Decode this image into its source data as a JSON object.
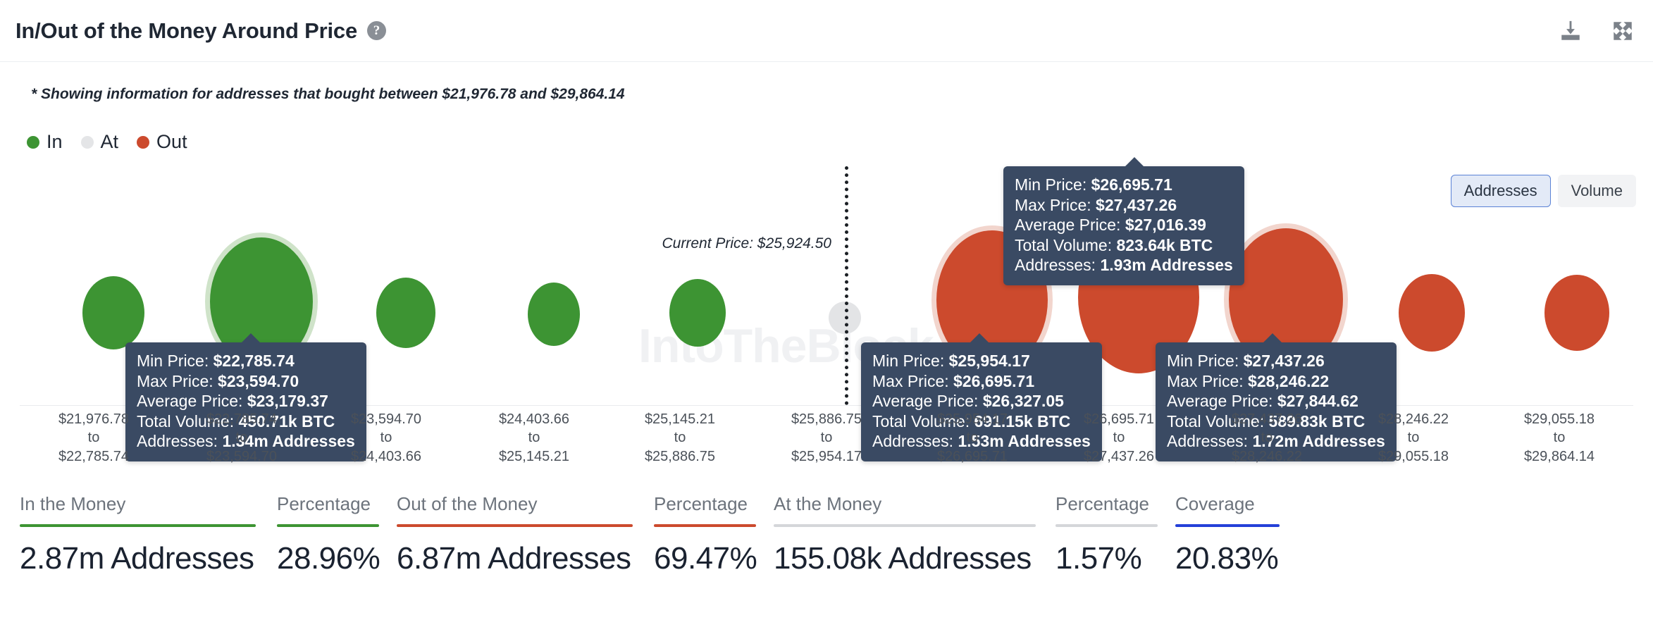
{
  "header": {
    "title": "In/Out of the Money Around Price",
    "help_icon": "question-mark-icon",
    "download_label": "download-icon",
    "expand_label": "fullscreen-icon"
  },
  "subnote": "* Showing information for addresses that bought between $21,976.78 and $29,864.14",
  "legend": {
    "items": [
      {
        "label": "In",
        "color": "#3d9433"
      },
      {
        "label": "At",
        "color": "#e4e5e7"
      },
      {
        "label": "Out",
        "color": "#cc4a2d"
      }
    ]
  },
  "series_toggle": {
    "options": [
      {
        "label": "Addresses",
        "active": true
      },
      {
        "label": "Volume",
        "active": false
      }
    ]
  },
  "current_price": {
    "label": "Current Price: $25,924.50",
    "value": "$25,924.50"
  },
  "watermark": {
    "text": "IntoTheBlock"
  },
  "chart_data": {
    "type": "bar",
    "title": "In/Out of the Money Around Price",
    "xlabel": "",
    "ylabel": "Addresses",
    "grid": false,
    "legend_position": "top-left",
    "current_price": 25924.5,
    "unit": "Addresses",
    "categories": [
      "$21,976.78\nto\n$22,785.74",
      "$22,785.74\nto\n$23,594.70",
      "$23,594.70\nto\n$24,403.66",
      "$24,403.66\nto\n$25,145.21",
      "$25,145.21\nto\n$25,886.75",
      "$25,886.75\nto\n$25,954.17",
      "$25,954.17\nto\n$26,695.71",
      "$26,695.71\nto\n$27,437.26",
      "$27,437.26\nto\n$28,246.22",
      "$28,246.22\nto\n$29,055.18",
      "$29,055.18\nto\n$29,864.14"
    ],
    "points": [
      {
        "min_price": "$21,976.78",
        "max_price": "$22,785.74",
        "state": "in",
        "addresses": "0.62m",
        "value": 0.62
      },
      {
        "min_price": "$22,785.74",
        "max_price": "$23,594.70",
        "average_price": "$23,179.37",
        "total_volume": "450.71k BTC",
        "addresses": "1.34m Addresses",
        "state": "in",
        "value": 1.34,
        "hovered": true
      },
      {
        "min_price": "$23,594.70",
        "max_price": "$24,403.66",
        "state": "in",
        "addresses": "0.55m",
        "value": 0.55
      },
      {
        "min_price": "$24,403.66",
        "max_price": "$25,145.21",
        "state": "in",
        "addresses": "0.42m",
        "value": 0.42
      },
      {
        "min_price": "$25,145.21",
        "max_price": "$25,886.75",
        "state": "in",
        "addresses": "0.50m",
        "value": 0.5
      },
      {
        "min_price": "$25,886.75",
        "max_price": "$25,954.17",
        "state": "at",
        "addresses": "155.08k",
        "value": 0.155
      },
      {
        "min_price": "$25,954.17",
        "max_price": "$26,695.71",
        "average_price": "$26,327.05",
        "total_volume": "691.15k BTC",
        "addresses": "1.53m Addresses",
        "state": "out",
        "value": 1.53,
        "hovered": true
      },
      {
        "min_price": "$26,695.71",
        "max_price": "$27,437.26",
        "average_price": "$27,016.39",
        "total_volume": "823.64k BTC",
        "addresses": "1.93m Addresses",
        "state": "out",
        "value": 1.93,
        "hovered": true
      },
      {
        "min_price": "$27,437.26",
        "max_price": "$28,246.22",
        "average_price": "$27,844.62",
        "total_volume": "589.83k BTC",
        "addresses": "1.72m Addresses",
        "state": "out",
        "value": 1.72,
        "hovered": true
      },
      {
        "min_price": "$28,246.22",
        "max_price": "$29,055.18",
        "state": "out",
        "addresses": "0.62m",
        "value": 0.62
      },
      {
        "min_price": "$29,055.18",
        "max_price": "$29,864.14",
        "state": "out",
        "addresses": "0.60m",
        "value": 0.6
      }
    ]
  },
  "tooltips": [
    {
      "id": "tooltip-bin-2",
      "min_price_label": "Min Price: ",
      "min_price": "$22,785.74",
      "max_price_label": "Max Price: ",
      "max_price": "$23,594.70",
      "avg_price_label": "Average Price: ",
      "avg_price": "$23,179.37",
      "volume_label": "Total Volume: ",
      "volume": "450.71k BTC",
      "addresses_label": "Addresses: ",
      "addresses": "1.34m Addresses"
    },
    {
      "id": "tooltip-bin-8",
      "min_price_label": "Min Price: ",
      "min_price": "$26,695.71",
      "max_price_label": "Max Price: ",
      "max_price": "$27,437.26",
      "avg_price_label": "Average Price: ",
      "avg_price": "$27,016.39",
      "volume_label": "Total Volume: ",
      "volume": "823.64k BTC",
      "addresses_label": "Addresses: ",
      "addresses": "1.93m Addresses"
    },
    {
      "id": "tooltip-bin-7",
      "min_price_label": "Min Price: ",
      "min_price": "$25,954.17",
      "max_price_label": "Max Price: ",
      "max_price": "$26,695.71",
      "avg_price_label": "Average Price: ",
      "avg_price": "$26,327.05",
      "volume_label": "Total Volume: ",
      "volume": "691.15k BTC",
      "addresses_label": "Addresses: ",
      "addresses": "1.53m Addresses"
    },
    {
      "id": "tooltip-bin-9",
      "min_price_label": "Min Price: ",
      "min_price": "$27,437.26",
      "max_price_label": "Max Price: ",
      "max_price": "$28,246.22",
      "avg_price_label": "Average Price: ",
      "avg_price": "$27,844.62",
      "volume_label": "Total Volume: ",
      "volume": "589.83k BTC",
      "addresses_label": "Addresses: ",
      "addresses": "1.72m Addresses"
    }
  ],
  "xaxis": {
    "labels": [
      {
        "from": "$21,976.78",
        "sep": "to",
        "to": "$22,785.74"
      },
      {
        "from": "$22,785.74",
        "sep": "to",
        "to": "$23,594.70"
      },
      {
        "from": "$23,594.70",
        "sep": "to",
        "to": "$24,403.66"
      },
      {
        "from": "$24,403.66",
        "sep": "to",
        "to": "$25,145.21"
      },
      {
        "from": "$25,145.21",
        "sep": "to",
        "to": "$25,886.75"
      },
      {
        "from": "$25,886.75",
        "sep": "to",
        "to": "$25,954.17"
      },
      {
        "from": "$25,954.17",
        "sep": "to",
        "to": "$26,695.71"
      },
      {
        "from": "$26,695.71",
        "sep": "to",
        "to": "$27,437.26"
      },
      {
        "from": "$27,437.26",
        "sep": "to",
        "to": "$28,246.22"
      },
      {
        "from": "$28,246.22",
        "sep": "to",
        "to": "$29,055.18"
      },
      {
        "from": "$29,055.18",
        "sep": "to",
        "to": "$29,864.14"
      }
    ]
  },
  "stats": [
    {
      "label": "In the Money",
      "value": "2.87m Addresses",
      "color": "#3d9433"
    },
    {
      "label": "Percentage",
      "value": "28.96%",
      "color": "#3d9433"
    },
    {
      "label": "Out of the Money",
      "value": "6.87m Addresses",
      "color": "#cc4a2d"
    },
    {
      "label": "Percentage",
      "value": "69.47%",
      "color": "#cc4a2d"
    },
    {
      "label": "At the Money",
      "value": "155.08k Addresses",
      "color": "#d4d6d9"
    },
    {
      "label": "Percentage",
      "value": "1.57%",
      "color": "#d4d6d9"
    },
    {
      "label": "Coverage",
      "value": "20.83%",
      "color": "#2440d8"
    }
  ],
  "colors": {
    "in": "#3d9433",
    "at": "#e4e5e7",
    "out": "#cc4a2d",
    "tooltip_bg": "#3a4a63",
    "coverage": "#2440d8"
  }
}
